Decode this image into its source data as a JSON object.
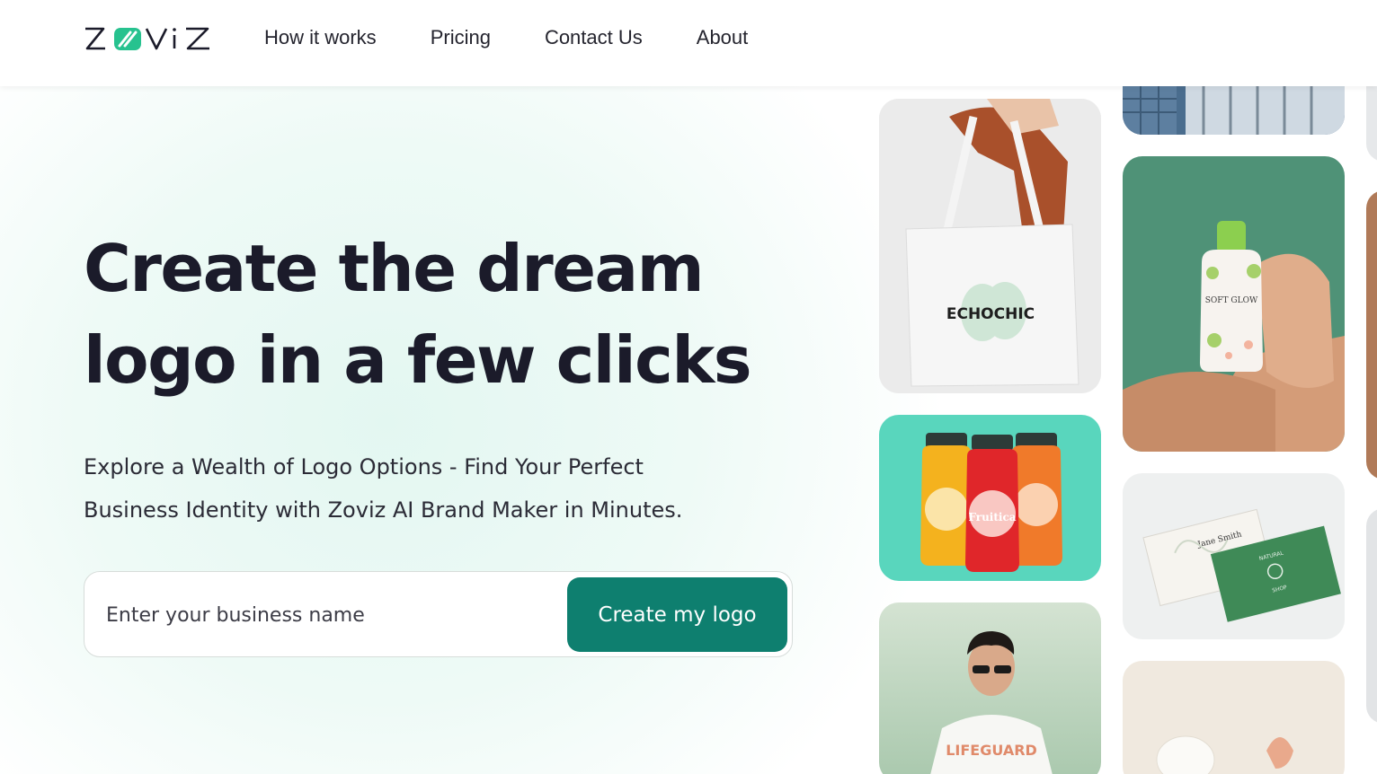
{
  "brand": {
    "name": "ZOVIZ",
    "accent": "#0e7f6f",
    "mark_green": "#27c28f"
  },
  "nav": {
    "items": [
      {
        "label": "How it works"
      },
      {
        "label": "Pricing"
      },
      {
        "label": "Contact Us"
      },
      {
        "label": "About"
      }
    ]
  },
  "hero": {
    "title_line1": "Create the dream",
    "title_line2": "logo in a few clicks",
    "subtitle_line1": "Explore a Wealth of Logo Options - Find Your Perfect",
    "subtitle_line2": "Business Identity with Zoviz AI Brand Maker in Minutes.",
    "input_placeholder": "Enter your business name",
    "cta_label": "Create my logo"
  },
  "gallery": {
    "tote_brand": "ECHOCHIC",
    "bottle_brand": "SOFT GLOW",
    "juice_brand": "Fruitica",
    "card_name": "Jane Smith",
    "card_shop_top": "NATURAL",
    "card_shop_bottom": "SHOP",
    "tshirt_text": "LIFEGUARD"
  }
}
